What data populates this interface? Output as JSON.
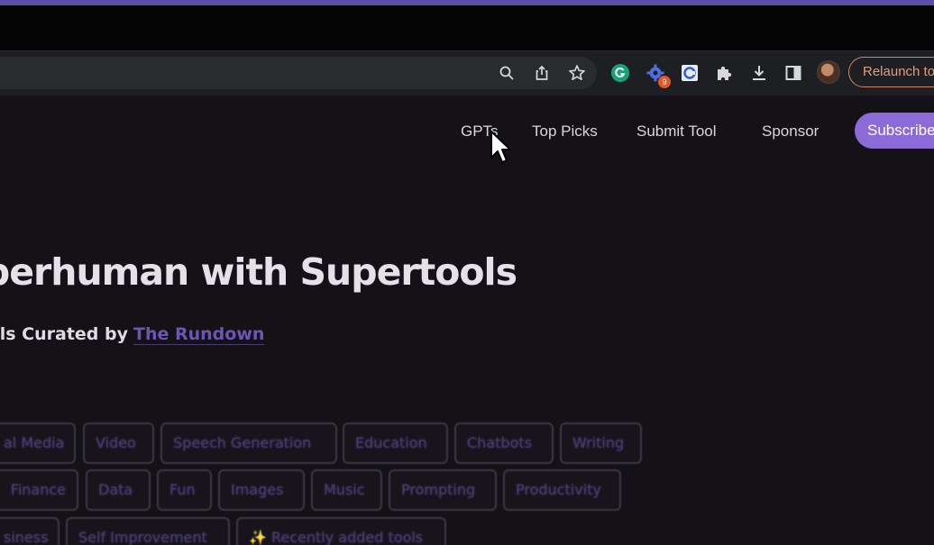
{
  "browser": {
    "relaunch_label": "Relaunch to",
    "extension_badge": "9",
    "icons": [
      "zoom-icon",
      "share-icon",
      "bookmark-star-icon",
      "grammarly-icon",
      "extension-gear-icon",
      "extension-c-icon",
      "puzzle-extensions-icon",
      "download-icon",
      "side-panel-icon",
      "profile-avatar"
    ]
  },
  "nav": {
    "gpts": "GPTs",
    "top_picks": "Top Picks",
    "submit_tool": "Submit Tool",
    "sponsor": "Sponsor",
    "subscribe": "Subscribe"
  },
  "hero": {
    "title": "perhuman with Supertools",
    "subtitle_prefix": "ls Curated by",
    "subtitle_link": "The Rundown"
  },
  "categories": {
    "row1": [
      "al Media",
      "Video",
      "Speech Generation",
      "Education",
      "Chatbots",
      "Writing"
    ],
    "row2": [
      "Finance",
      "Data",
      "Fun",
      "Images",
      "Music",
      "Prompting",
      "Productivity"
    ],
    "row3": [
      "siness",
      "Self Improvement",
      "✨ Recently added tools"
    ]
  },
  "colors": {
    "accent": "#8c6bd9",
    "page_bg": "#141217",
    "relaunch": "#e79a82",
    "link": "#6f55b3"
  }
}
